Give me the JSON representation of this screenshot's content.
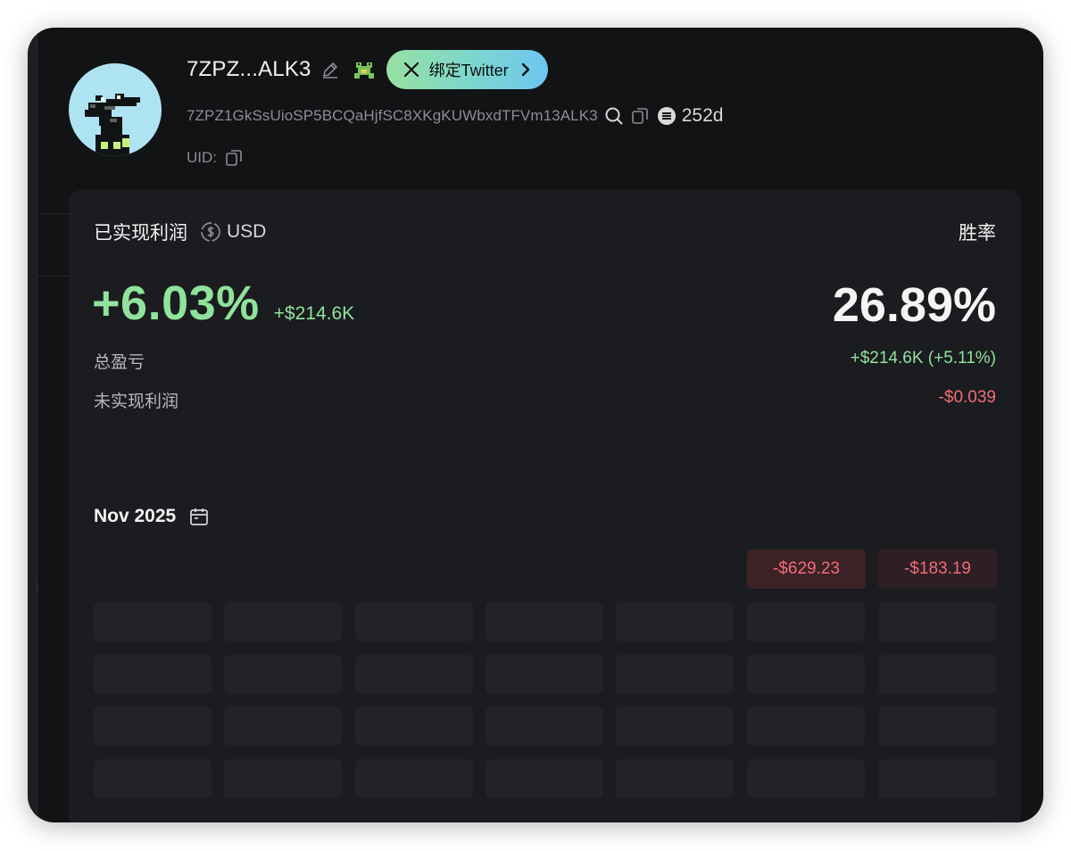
{
  "profile": {
    "display_name": "7ZPZ...ALK3",
    "address": "7ZPZ1GkSsUioSP5BCQaHjfSC8XKgKUWbxdTFVm13ALK3",
    "age": "252d",
    "uid_label": "UID:",
    "twitter_button_label": "绑定Twitter"
  },
  "icons": {
    "avatar": "pixel-crocodile-avatar",
    "edit": "pencil-icon",
    "badge": "frog-icon",
    "x": "x-logo-icon",
    "chevron": "chevron-right-icon",
    "search": "search-icon",
    "copy": "copy-icon",
    "platform": "platform-logo-icon",
    "currency": "currency-switch-icon",
    "calendar": "calendar-icon"
  },
  "pnl": {
    "title": "已实现利润",
    "currency": "USD",
    "realized_pct": "+6.03%",
    "realized_usd": "+$214.6K",
    "winrate_label": "胜率",
    "winrate": "26.89%",
    "total_label": "总盈亏",
    "total_value": "+$214.6K (+5.11%)",
    "unrealized_label": "未实现利润",
    "unrealized_value": "-$0.039"
  },
  "calendar": {
    "month": "Nov 2025",
    "pills": [
      "-$629.23",
      "-$183.19"
    ]
  },
  "colors": {
    "background": "#121315",
    "card": "#1b1c1f",
    "positive": "#8fe39c",
    "negative": "#f06c78",
    "twitter_gradient_start": "#97e0a0",
    "twitter_gradient_end": "#6dc6f0"
  }
}
